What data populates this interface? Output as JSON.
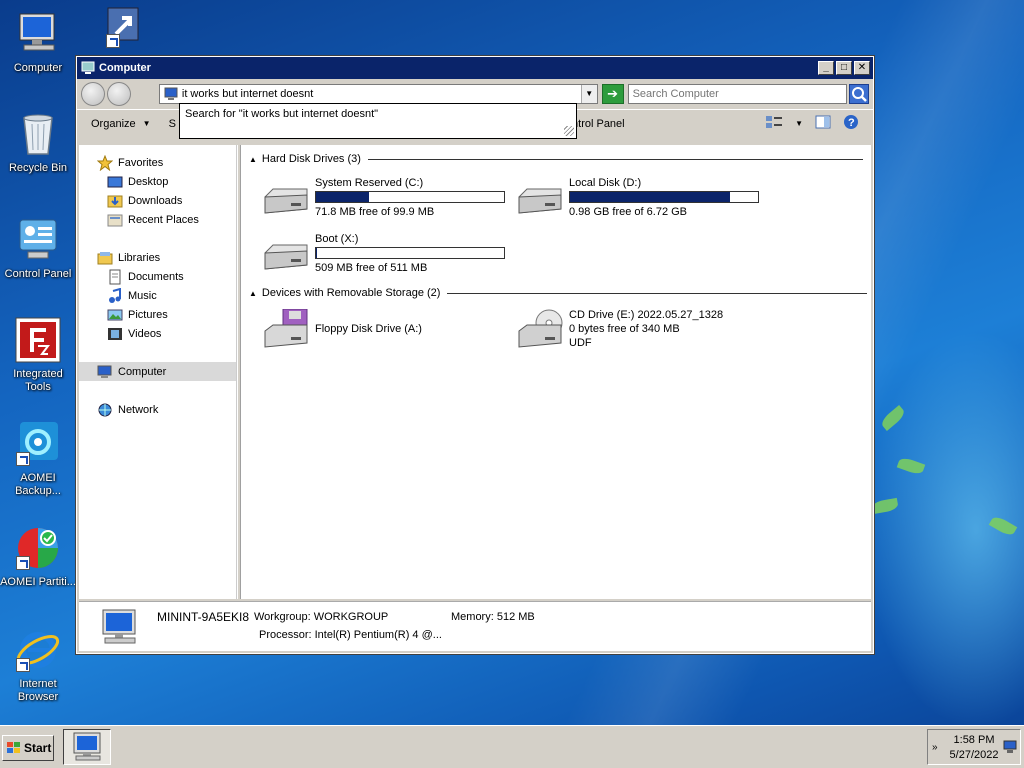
{
  "desktop": {
    "icons": [
      {
        "label": "Computer"
      },
      {
        "label": ""
      },
      {
        "label": "Recycle Bin"
      },
      {
        "label": "Control Panel"
      },
      {
        "label": "Integrated Tools"
      },
      {
        "label": "AOMEI Backup..."
      },
      {
        "label": "AOMEI Partiti..."
      },
      {
        "label": "Internet Browser"
      }
    ]
  },
  "window": {
    "title": "Computer",
    "title_buttons": {
      "minimize": "_",
      "maximize": "□",
      "close": "✕"
    },
    "address": {
      "value": "it works but internet doesnt",
      "autocomplete": "Search for \"it works but internet doesnt\""
    },
    "search": {
      "placeholder": "Search Computer"
    },
    "toolbar": {
      "organize": "Organize",
      "hidden_item": "S",
      "control_panel": "ontrol Panel"
    },
    "nav": {
      "favorites": "Favorites",
      "desktop": "Desktop",
      "downloads": "Downloads",
      "recent": "Recent Places",
      "libraries": "Libraries",
      "documents": "Documents",
      "music": "Music",
      "pictures": "Pictures",
      "videos": "Videos",
      "computer": "Computer",
      "network": "Network"
    },
    "groups": {
      "hdd": "Hard Disk Drives (3)",
      "removable": "Devices with Removable Storage (2)"
    },
    "drives": [
      {
        "name": "System Reserved (C:)",
        "free": "71.8 MB free of 99.9 MB",
        "used_fraction": 0.28
      },
      {
        "name": "Local Disk (D:)",
        "free": "0.98 GB free of 6.72 GB",
        "used_fraction": 0.85
      },
      {
        "name": "Boot (X:)",
        "free": "509 MB free of 511 MB",
        "used_fraction": 0.004
      }
    ],
    "removable": [
      {
        "name": "Floppy Disk Drive (A:)"
      },
      {
        "name": "CD Drive (E:) 2022.05.27_1328",
        "line2": "0 bytes free of 340 MB",
        "line3": "UDF"
      }
    ],
    "details": {
      "computer_name": "MININT-9A5EKI8",
      "workgroup": "Workgroup: WORKGROUP",
      "memory": "Memory: 512 MB",
      "processor": "Processor: Intel(R) Pentium(R) 4   @..."
    }
  },
  "taskbar": {
    "start": "Start",
    "time": "1:58 PM",
    "date": "5/27/2022",
    "tray_arrow": "»"
  },
  "colors": {
    "titlebar": "#0a246a",
    "drive_fill": "#0b246a",
    "desktop": "#1465c0"
  }
}
